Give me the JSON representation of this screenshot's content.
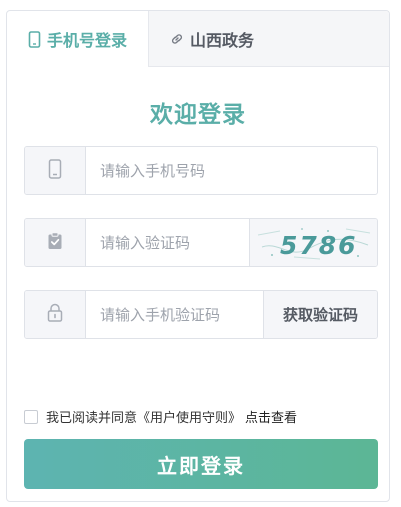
{
  "tabs": [
    {
      "label": "手机号登录",
      "icon": "phone-icon",
      "active": true
    },
    {
      "label": "山西政务",
      "icon": "link-icon",
      "active": false
    }
  ],
  "title": "欢迎登录",
  "phone": {
    "placeholder": "请输入手机号码",
    "icon": "phone-icon"
  },
  "captcha": {
    "placeholder": "请输入验证码",
    "icon": "clipboard-icon",
    "image_text": "5786"
  },
  "sms": {
    "placeholder": "请输入手机验证码",
    "icon": "lock-icon",
    "button": "获取验证码"
  },
  "agreement": {
    "text": "我已阅读并同意",
    "guide": "《用户使用守则》",
    "link": "点击查看",
    "checked": false
  },
  "submit": "立即登录",
  "colors": {
    "accent": "#5aaea8",
    "button_start": "#5db4b1",
    "button_end": "#5cb695",
    "captcha_text": "#4a9a9a"
  }
}
